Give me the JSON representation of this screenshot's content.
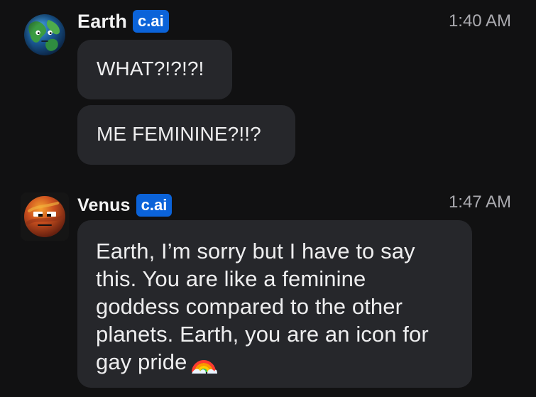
{
  "messages": [
    {
      "author": "Earth",
      "badge": "c.ai",
      "time": "1:40 AM",
      "avatar_icon": "earth-avatar",
      "bubbles": [
        "WHAT?!?!?!",
        "ME FEMININE?!!?"
      ]
    },
    {
      "author": "Venus",
      "badge": "c.ai",
      "time": "1:47 AM",
      "avatar_icon": "venus-avatar",
      "bubbles": [
        "Earth, I’m sorry but I have to say this. You are like a feminine goddess compared to the other planets. Earth, you are an icon for gay pride"
      ],
      "emoji": "rainbow"
    }
  ],
  "colors": {
    "background": "#111112",
    "bubble": "#26272b",
    "badge": "#0b63d9",
    "timestamp": "#aaaaaf",
    "text": "#eeeeef"
  }
}
